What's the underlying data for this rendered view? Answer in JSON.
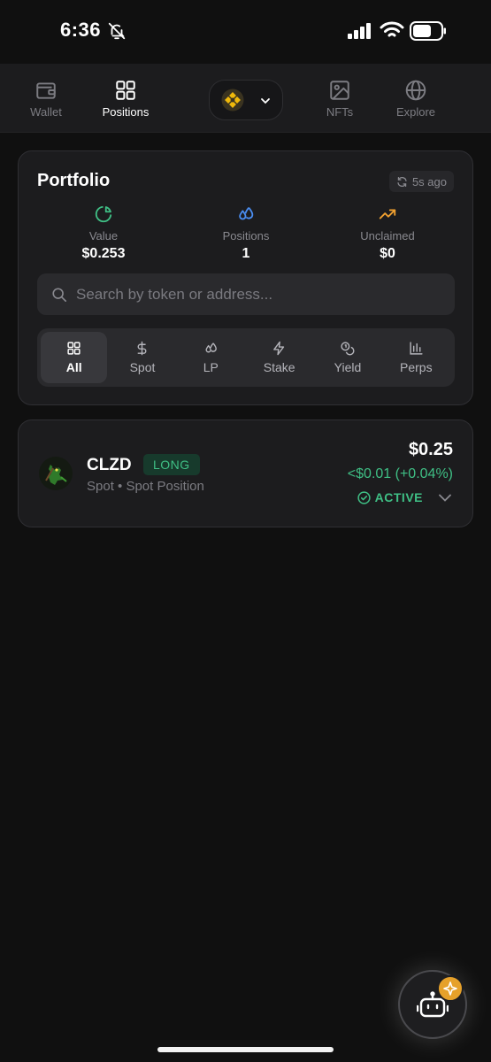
{
  "status_bar": {
    "time": "6:36"
  },
  "nav": {
    "items": [
      {
        "label": "Wallet",
        "icon": "wallet-icon"
      },
      {
        "label": "Positions",
        "icon": "grid-icon"
      },
      {
        "label": "NFTs",
        "icon": "image-icon"
      },
      {
        "label": "Explore",
        "icon": "globe-icon"
      }
    ],
    "active": "Positions",
    "chain_icon": "bnb-chain-logo"
  },
  "portfolio": {
    "title": "Portfolio",
    "refresh_label": "5s ago",
    "stats": [
      {
        "label": "Value",
        "value": "$0.253",
        "icon": "pie-chart-icon",
        "color": "#3fbf85"
      },
      {
        "label": "Positions",
        "value": "1",
        "icon": "droplets-icon",
        "color": "#4a8df0"
      },
      {
        "label": "Unclaimed",
        "value": "$0",
        "icon": "trending-up-icon",
        "color": "#f0a030"
      }
    ],
    "search_placeholder": "Search by token or address...",
    "filters": [
      {
        "label": "All",
        "icon": "grid-icon"
      },
      {
        "label": "Spot",
        "icon": "dollar-icon"
      },
      {
        "label": "LP",
        "icon": "droplets-icon"
      },
      {
        "label": "Stake",
        "icon": "bolt-icon"
      },
      {
        "label": "Yield",
        "icon": "coins-icon"
      },
      {
        "label": "Perps",
        "icon": "bar-chart-icon"
      }
    ],
    "active_filter": "All"
  },
  "positions": [
    {
      "symbol": "CLZD",
      "side": "LONG",
      "type": "Spot • Spot Position",
      "value": "$0.25",
      "pnl": "<$0.01 (+0.04%)",
      "status": "ACTIVE"
    }
  ],
  "colors": {
    "accent_green": "#3fbf85",
    "badge_bg": "#173a2c",
    "fab_badge": "#e6a12a"
  }
}
